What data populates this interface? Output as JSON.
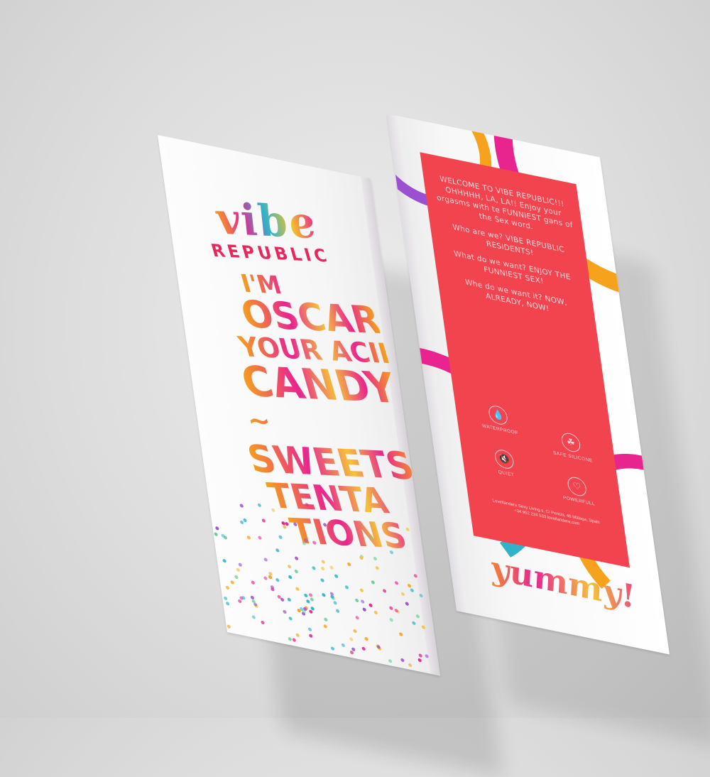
{
  "front": {
    "logo_main": "vibe",
    "logo_sub": "REPUBLIC",
    "slogan": [
      "I'M",
      "OSCAR",
      "YOUR ACID",
      "CANDY",
      "~",
      "SWEETS",
      "TENTA",
      "TIONS"
    ]
  },
  "back": {
    "paragraphs": [
      "WELCOME TO VIBE REPUBLIC!!! OHHHHH, LA, LA!! Enjoy your orgasms with te FUNNIEST gans of the Sex word.",
      "Who are we? VIBE REPUBLIC RESIDENTS!",
      "What do we want? ENJOY THE FUNNIEST SEX!",
      "Whe do we want it? NOW, ALREADY, NOW!"
    ],
    "features": [
      {
        "icon": "drop-icon",
        "label": "WATERPROOF"
      },
      {
        "icon": "leaf-icon",
        "label": "SAFE SILICONE"
      },
      {
        "icon": "mute-icon",
        "label": "QUIET"
      },
      {
        "icon": "heart-icon",
        "label": "POWERFULL"
      }
    ],
    "address": "LoveIlandera Sexy Living s. C/ Pericia, 46 Málaga, Spain +34 952 224 533 loveilandera.com",
    "tagline": "yummy!"
  },
  "colors": {
    "panel": "#f2444f",
    "accent_pink": "#e8258f",
    "accent_orange": "#f6a21c",
    "logo_red": "#e8275c"
  }
}
